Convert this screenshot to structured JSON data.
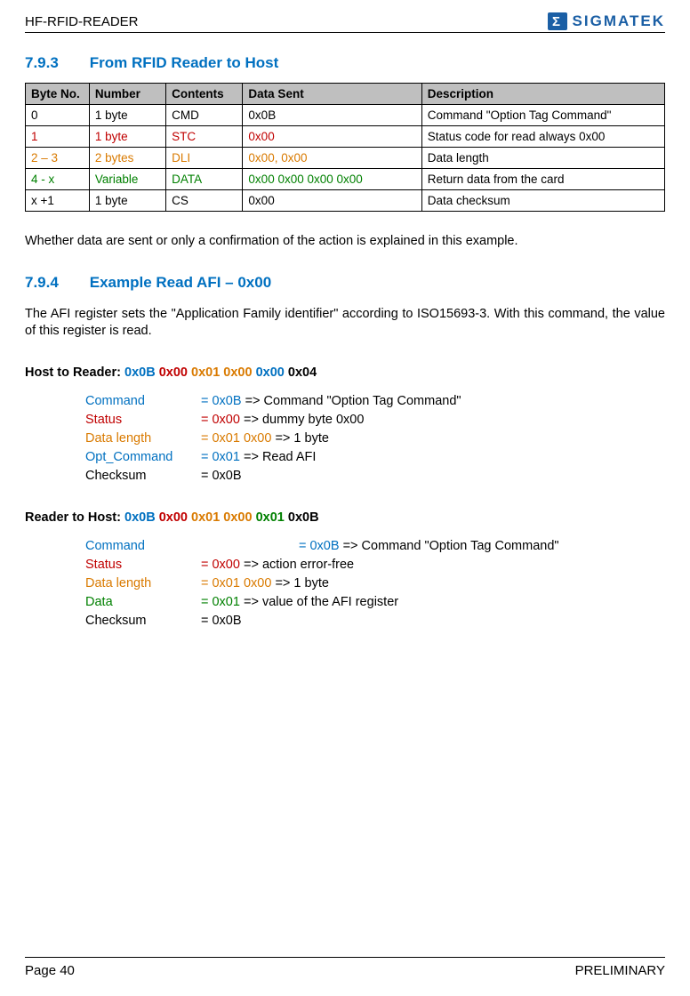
{
  "header": {
    "doc_title": "HF-RFID-READER",
    "logo_text": "SIGMATEK",
    "logo_sigma": "Σ"
  },
  "section793": {
    "number": "7.9.3",
    "title": "From RFID Reader to Host"
  },
  "table": {
    "headers": {
      "byteno": "Byte No.",
      "number": "Number",
      "contents": "Contents",
      "datasent": "Data Sent",
      "description": "Description"
    },
    "rows": [
      {
        "color": "",
        "byteno": "0",
        "number": "1 byte",
        "contents": "CMD",
        "datasent": "0x0B",
        "description": "Command \"Option Tag Command\""
      },
      {
        "color": "c-red",
        "byteno": "1",
        "number": "1 byte",
        "contents": "STC",
        "datasent": "0x00",
        "description": "Status code for read always 0x00"
      },
      {
        "color": "c-orange",
        "byteno": "2 – 3",
        "number": "2 bytes",
        "contents": "DLI",
        "datasent": "0x00, 0x00",
        "description": "Data length"
      },
      {
        "color": "c-green",
        "byteno": "4 - x",
        "number": "Variable",
        "contents": "DATA",
        "datasent": "0x00 0x00 0x00 0x00",
        "description": "Return data from the card"
      },
      {
        "color": "",
        "byteno": "x +1",
        "number": "1 byte",
        "contents": "CS",
        "datasent": "0x00",
        "description": "Data checksum"
      }
    ]
  },
  "note793": "Whether data are sent or only a confirmation of the action is explained in this example.",
  "section794": {
    "number": "7.9.4",
    "title": "Example Read AFI – 0x00",
    "intro": "The AFI register sets the \"Application Family identifier\" according to ISO15693-3. With this command, the value of this register is read."
  },
  "host_to_reader": {
    "label": "Host to Reader:",
    "bytes": {
      "b1": "0x0B",
      "b2": "0x00",
      "b3": "0x01 0x00",
      "b4": "0x00",
      "b5": "0x04"
    },
    "fields": [
      {
        "name": "Command",
        "ncolor": "c-blue",
        "val": "= 0x0B",
        "vcolor": "c-blue",
        "expl": " => Command \"Option Tag Command\""
      },
      {
        "name": "Status",
        "ncolor": "c-red",
        "val": "= 0x00",
        "vcolor": "c-red",
        "expl": " => dummy byte 0x00"
      },
      {
        "name": "Data length",
        "ncolor": "c-orange",
        "val": "= 0x01 0x00",
        "vcolor": "c-orange",
        "expl": " => 1 byte"
      },
      {
        "name": "Opt_Command",
        "ncolor": "c-blue",
        "val": "= 0x01",
        "vcolor": "c-blue",
        "expl": " => Read AFI"
      },
      {
        "name": "Checksum",
        "ncolor": "",
        "val": "= 0x0B",
        "vcolor": "",
        "expl": ""
      }
    ]
  },
  "reader_to_host": {
    "label": "Reader to Host:",
    "bytes": {
      "b1": "0x0B",
      "b2": "0x00",
      "b3": "0x01 0x00",
      "b4": "0x01",
      "b5": "0x0B"
    },
    "fields": [
      {
        "name": "Command",
        "ncolor": "c-blue",
        "val": "= 0x0B",
        "vcolor": "c-blue",
        "expl": " => Command \"Option Tag Command\"",
        "wide": true
      },
      {
        "name": "Status",
        "ncolor": "c-red",
        "val": "= 0x00",
        "vcolor": "c-red",
        "expl": " => action error-free"
      },
      {
        "name": "Data length",
        "ncolor": "c-orange",
        "val": "= 0x01 0x00",
        "vcolor": "c-orange",
        "expl": " => 1 byte"
      },
      {
        "name": "Data",
        "ncolor": "c-green",
        "val": "= 0x01",
        "vcolor": "c-green",
        "expl": " => value of the AFI register"
      },
      {
        "name": "Checksum",
        "ncolor": "",
        "val": "= 0x0B",
        "vcolor": "",
        "expl": ""
      }
    ]
  },
  "footer": {
    "page": "Page 40",
    "status": "PRELIMINARY"
  }
}
